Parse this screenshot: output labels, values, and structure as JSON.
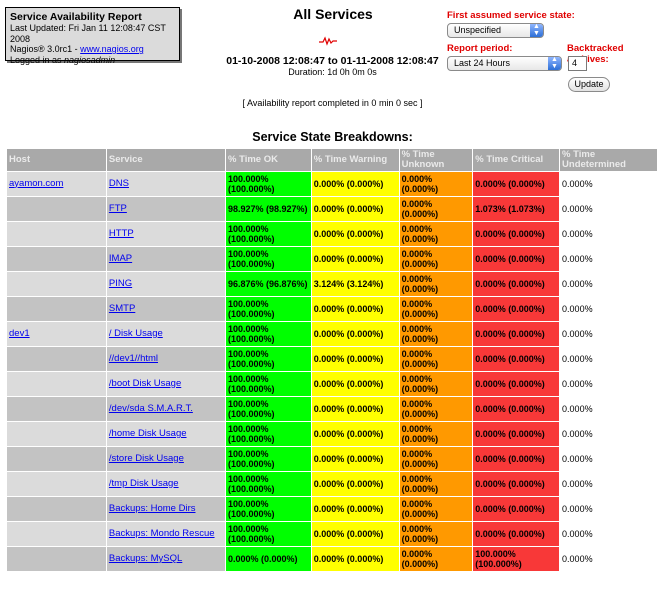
{
  "infobox": {
    "title": "Service Availability Report",
    "last_updated": "Last Updated: Fri Jan 11 12:08:47 CST 2008",
    "version_prefix": "Nagios® 3.0rc1 - ",
    "version_link": "www.nagios.org",
    "logged_in_prefix": "Logged in as ",
    "logged_in_user": "nagiosadmin"
  },
  "report": {
    "title": "All Services",
    "date_range": "01-10-2008 12:08:47 to 01-11-2008 12:08:47",
    "duration": "Duration: 1d 0h 0m 0s",
    "completed": "[ Availability report completed in 0 min 0 sec ]",
    "section_title": "Service State Breakdowns:"
  },
  "controls": {
    "first_state_label": "First assumed service state:",
    "first_state_value": "Unspecified",
    "period_label": "Report period:",
    "period_value": "Last 24 Hours",
    "backtracked_label": "Backtracked archives:",
    "backtracked_value": "4",
    "update_label": "Update"
  },
  "colors": {
    "ok": "#00ff00",
    "warning": "#ffff00",
    "unknown": "#ff9900",
    "critical": "#f83838"
  },
  "table": {
    "headers": [
      "Host",
      "Service",
      "% Time OK",
      "% Time Warning",
      "% Time Unknown",
      "% Time Critical",
      "% Time Undetermined"
    ],
    "rows": [
      {
        "host": "ayamon.com",
        "service": "DNS",
        "ok": "100.000% (100.000%)",
        "warning": "0.000% (0.000%)",
        "unknown": "0.000% (0.000%)",
        "critical": "0.000% (0.000%)",
        "undetermined": "0.000%"
      },
      {
        "host": "",
        "service": "FTP",
        "ok": "98.927% (98.927%)",
        "warning": "0.000% (0.000%)",
        "unknown": "0.000% (0.000%)",
        "critical": "1.073% (1.073%)",
        "undetermined": "0.000%"
      },
      {
        "host": "",
        "service": "HTTP",
        "ok": "100.000% (100.000%)",
        "warning": "0.000% (0.000%)",
        "unknown": "0.000% (0.000%)",
        "critical": "0.000% (0.000%)",
        "undetermined": "0.000%"
      },
      {
        "host": "",
        "service": "IMAP",
        "ok": "100.000% (100.000%)",
        "warning": "0.000% (0.000%)",
        "unknown": "0.000% (0.000%)",
        "critical": "0.000% (0.000%)",
        "undetermined": "0.000%"
      },
      {
        "host": "",
        "service": "PING",
        "ok": "96.876% (96.876%)",
        "warning": "3.124% (3.124%)",
        "unknown": "0.000% (0.000%)",
        "critical": "0.000% (0.000%)",
        "undetermined": "0.000%"
      },
      {
        "host": "",
        "service": "SMTP",
        "ok": "100.000% (100.000%)",
        "warning": "0.000% (0.000%)",
        "unknown": "0.000% (0.000%)",
        "critical": "0.000% (0.000%)",
        "undetermined": "0.000%"
      },
      {
        "host": "dev1",
        "service": "/ Disk Usage",
        "ok": "100.000% (100.000%)",
        "warning": "0.000% (0.000%)",
        "unknown": "0.000% (0.000%)",
        "critical": "0.000% (0.000%)",
        "undetermined": "0.000%"
      },
      {
        "host": "",
        "service": "//dev1//html",
        "ok": "100.000% (100.000%)",
        "warning": "0.000% (0.000%)",
        "unknown": "0.000% (0.000%)",
        "critical": "0.000% (0.000%)",
        "undetermined": "0.000%"
      },
      {
        "host": "",
        "service": "/boot Disk Usage",
        "ok": "100.000% (100.000%)",
        "warning": "0.000% (0.000%)",
        "unknown": "0.000% (0.000%)",
        "critical": "0.000% (0.000%)",
        "undetermined": "0.000%"
      },
      {
        "host": "",
        "service": "/dev/sda S.M.A.R.T.",
        "ok": "100.000% (100.000%)",
        "warning": "0.000% (0.000%)",
        "unknown": "0.000% (0.000%)",
        "critical": "0.000% (0.000%)",
        "undetermined": "0.000%"
      },
      {
        "host": "",
        "service": "/home Disk Usage",
        "ok": "100.000% (100.000%)",
        "warning": "0.000% (0.000%)",
        "unknown": "0.000% (0.000%)",
        "critical": "0.000% (0.000%)",
        "undetermined": "0.000%"
      },
      {
        "host": "",
        "service": "/store Disk Usage",
        "ok": "100.000% (100.000%)",
        "warning": "0.000% (0.000%)",
        "unknown": "0.000% (0.000%)",
        "critical": "0.000% (0.000%)",
        "undetermined": "0.000%"
      },
      {
        "host": "",
        "service": "/tmp Disk Usage",
        "ok": "100.000% (100.000%)",
        "warning": "0.000% (0.000%)",
        "unknown": "0.000% (0.000%)",
        "critical": "0.000% (0.000%)",
        "undetermined": "0.000%"
      },
      {
        "host": "",
        "service": "Backups: Home Dirs",
        "ok": "100.000% (100.000%)",
        "warning": "0.000% (0.000%)",
        "unknown": "0.000% (0.000%)",
        "critical": "0.000% (0.000%)",
        "undetermined": "0.000%"
      },
      {
        "host": "",
        "service": "Backups: Mondo Rescue",
        "ok": "100.000% (100.000%)",
        "warning": "0.000% (0.000%)",
        "unknown": "0.000% (0.000%)",
        "critical": "0.000% (0.000%)",
        "undetermined": "0.000%"
      },
      {
        "host": "",
        "service": "Backups: MySQL",
        "ok": "0.000% (0.000%)",
        "warning": "0.000% (0.000%)",
        "unknown": "0.000% (0.000%)",
        "critical": "100.000% (100.000%)",
        "undetermined": "0.000%"
      }
    ]
  }
}
